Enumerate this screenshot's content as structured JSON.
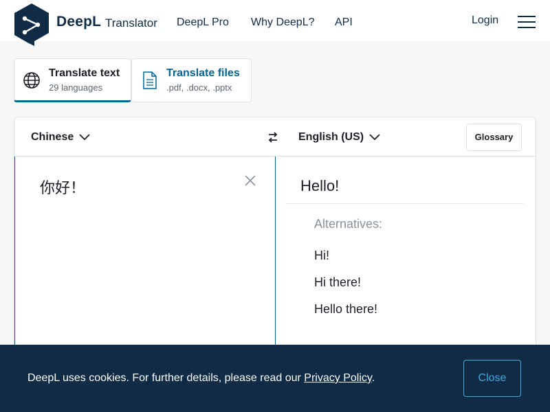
{
  "header": {
    "brand": "DeepL",
    "brand_sub": "Translator",
    "nav": [
      "DeepL Pro",
      "Why DeepL?",
      "API"
    ],
    "login": "Login"
  },
  "tabs": [
    {
      "title": "Translate text",
      "subtitle": "29 languages",
      "icon": "globe-icon",
      "active": true
    },
    {
      "title": "Translate files",
      "subtitle": ".pdf, .docx, .pptx",
      "icon": "document-icon",
      "active": false
    }
  ],
  "translator": {
    "source_lang": "Chinese",
    "target_lang": "English (US)",
    "glossary": "Glossary",
    "source_text": "你好！",
    "target_text": "Hello!",
    "alternatives_label": "Alternatives:",
    "alternatives": [
      "Hi!",
      "Hi there!",
      "Hello there!"
    ]
  },
  "cookie": {
    "text": "DeepL uses cookies. For further details, please read our ",
    "link": "Privacy Policy",
    "suffix": ".",
    "close": "Close"
  },
  "colors": {
    "brand": "#0f2b46",
    "accent": "#006494",
    "banner_button": "#40a9d8"
  }
}
